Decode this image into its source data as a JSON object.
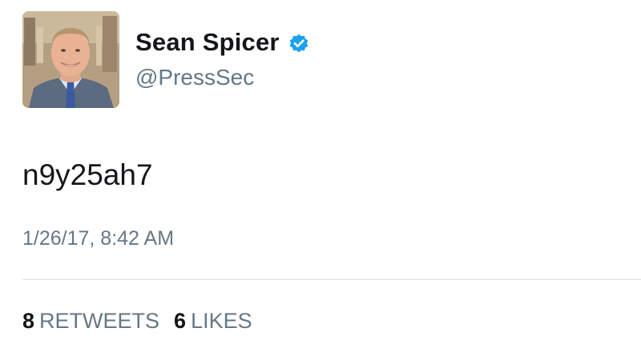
{
  "user": {
    "display_name": "Sean Spicer",
    "handle": "@PressSec",
    "verified": true
  },
  "tweet": {
    "text": "n9y25ah7",
    "timestamp": "1/26/17, 8:42 AM"
  },
  "stats": {
    "retweets_count": "8",
    "retweets_label": "RETWEETS",
    "likes_count": "6",
    "likes_label": "LIKES"
  },
  "colors": {
    "verified_badge": "#1da1f2",
    "secondary_text": "#657786",
    "primary_text": "#14171a",
    "divider": "#d8dde1"
  },
  "icons": {
    "verified": "verified-badge-icon"
  }
}
